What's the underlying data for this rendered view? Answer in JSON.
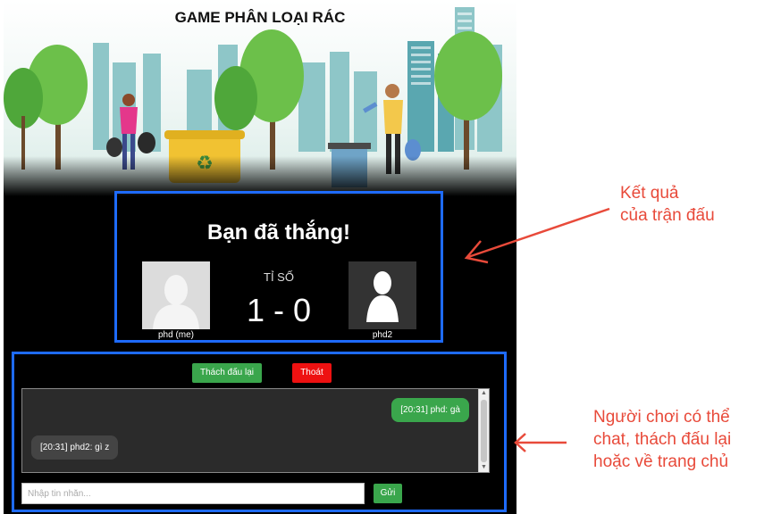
{
  "game": {
    "title": "GAME PHÂN LOẠI RÁC"
  },
  "result": {
    "message": "Bạn đã thắng!",
    "score_label": "TỈ SỐ",
    "score": "1 - 0",
    "player_me": "phd (me)",
    "player_opponent": "phd2"
  },
  "actions": {
    "rematch_label": "Thách đấu lại",
    "exit_label": "Thoát"
  },
  "chat": {
    "messages": [
      {
        "text": "[20:31] phd: gà",
        "side": "mine"
      },
      {
        "text": "[20:31] phd2: gì z",
        "side": "theirs"
      }
    ],
    "input_placeholder": "Nhập tin nhắn...",
    "send_label": "Gửi"
  },
  "annotations": {
    "result_note_line1": "Kết quả",
    "result_note_line2": "của trận đấu",
    "chat_note_line1": "Người chơi có thể",
    "chat_note_line2": "chat, thách đấu lại",
    "chat_note_line3": "hoặc về trang chủ"
  },
  "colors": {
    "highlight_border": "#1e6bff",
    "annotation_red": "#e84a3a",
    "button_green": "#3aa64c",
    "button_red": "#ee1111"
  }
}
